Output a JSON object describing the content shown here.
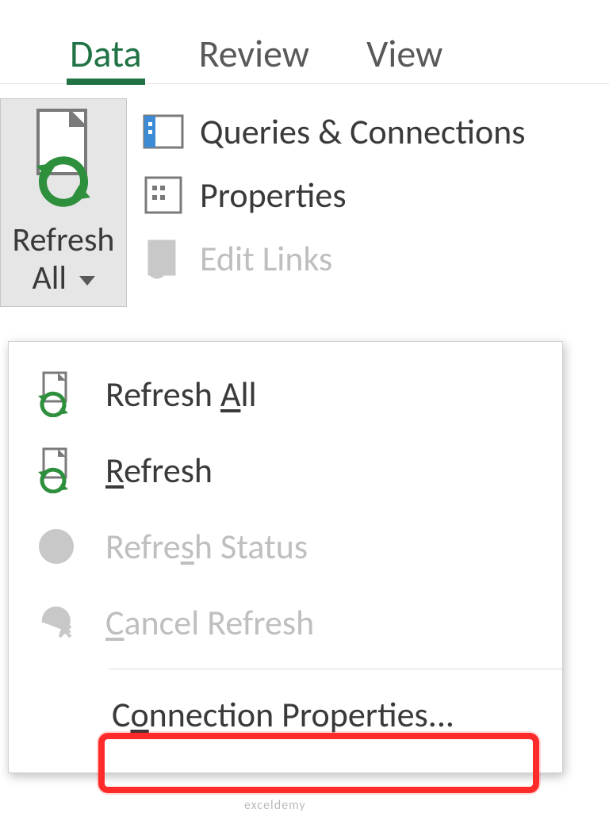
{
  "tabs": {
    "data": "Data",
    "review": "Review",
    "view": "View"
  },
  "ribbon": {
    "refresh_all_line1": "Refresh",
    "refresh_all_line2": "All",
    "queries_connections": "Queries & Connections",
    "properties": "Properties",
    "edit_links": "Edit Links"
  },
  "menu": {
    "refresh_all_pre": "Refresh ",
    "refresh_all_u": "A",
    "refresh_all_post": "ll",
    "refresh_u": "R",
    "refresh_post": "efresh",
    "refresh_status_pre": "Refre",
    "refresh_status_u": "s",
    "refresh_status_post": "h Status",
    "cancel_refresh_u": "C",
    "cancel_refresh_post": "ancel Refresh",
    "connection_props_pre": "C",
    "connection_props_u": "o",
    "connection_props_post": "nnection Properties..."
  },
  "watermark": "exceldemy"
}
